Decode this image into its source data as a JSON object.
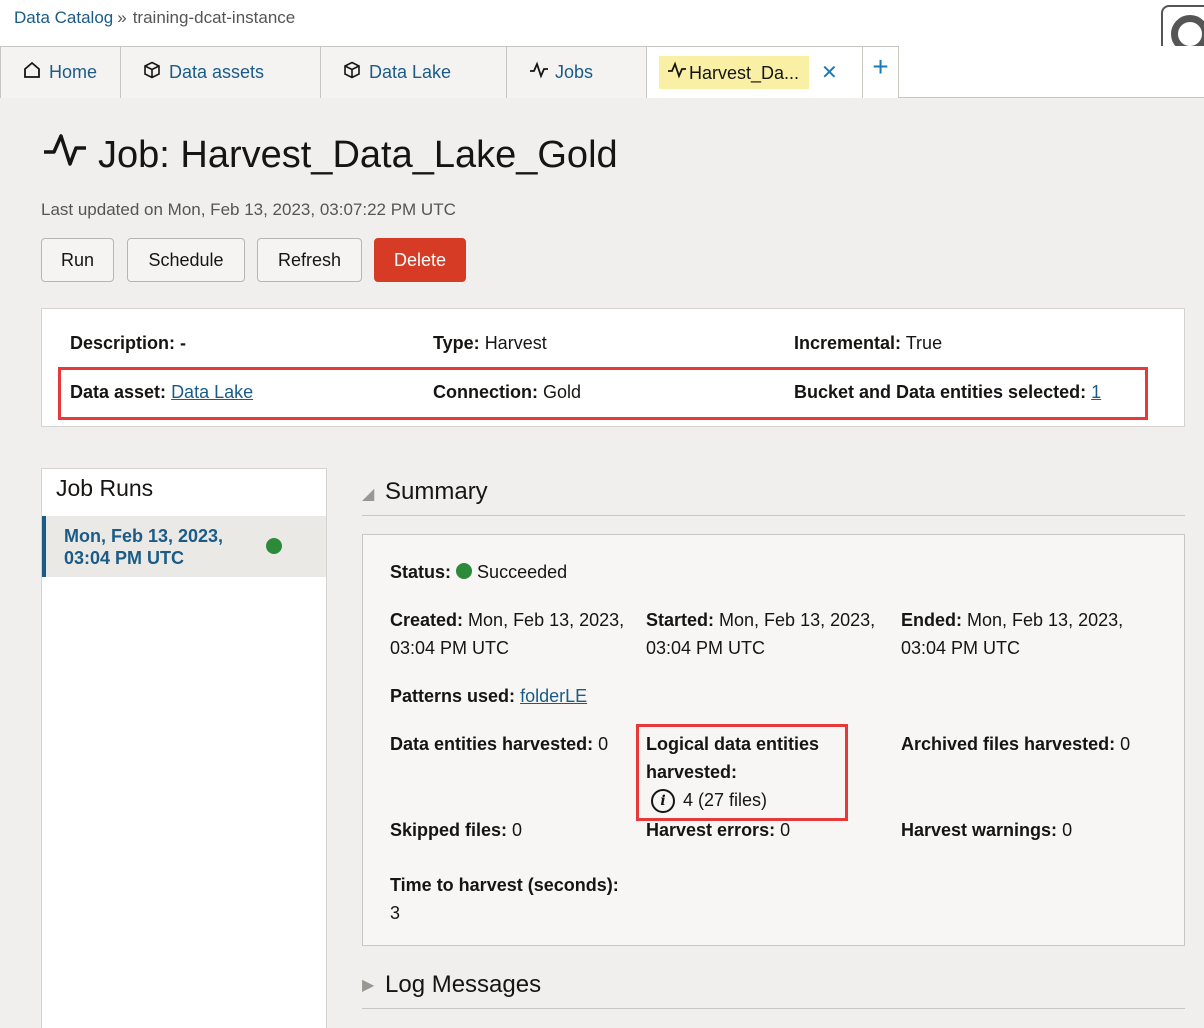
{
  "breadcrumb": {
    "root": "Data Catalog",
    "separator": "»",
    "current": "training-dcat-instance"
  },
  "tabs": [
    {
      "label": "Home",
      "icon": "home-icon"
    },
    {
      "label": "Data assets",
      "icon": "cube-icon"
    },
    {
      "label": "Data Lake",
      "icon": "cube-icon"
    },
    {
      "label": "Jobs",
      "icon": "activity-icon"
    },
    {
      "label": "Harvest_Da...",
      "icon": "activity-icon",
      "active": true
    }
  ],
  "tab_add": "+",
  "tab_close": "✕",
  "page": {
    "title": "Job: Harvest_Data_Lake_Gold",
    "last_updated": "Last updated on Mon, Feb 13, 2023, 03:07:22 PM UTC"
  },
  "actions": {
    "run": "Run",
    "schedule": "Schedule",
    "refresh": "Refresh",
    "delete": "Delete"
  },
  "details": {
    "description_label": "Description:",
    "description_value": "-",
    "type_label": "Type:",
    "type_value": "Harvest",
    "incremental_label": "Incremental:",
    "incremental_value": "True",
    "data_asset_label": "Data asset:",
    "data_asset_value": "Data Lake",
    "connection_label": "Connection:",
    "connection_value": "Gold",
    "bucket_label": "Bucket and Data entities selected:",
    "bucket_value": "1"
  },
  "job_runs": {
    "title": "Job Runs",
    "items": [
      {
        "line1": "Mon, Feb 13, 2023,",
        "line2": "03:04 PM UTC",
        "status_color": "#2d8a3a"
      }
    ]
  },
  "summary": {
    "heading": "Summary",
    "status_label": "Status:",
    "status_value": "Succeeded",
    "created_label": "Created:",
    "created_value1": "Mon, Feb 13, 2023,",
    "created_value2": "03:04 PM UTC",
    "started_label": "Started:",
    "started_value1": "Mon, Feb 13, 2023,",
    "started_value2": "03:04 PM UTC",
    "ended_label": "Ended:",
    "ended_value1": "Mon, Feb 13, 2023,",
    "ended_value2": "03:04 PM UTC",
    "patterns_label": "Patterns used:",
    "patterns_value": "folderLE",
    "entities_label": "Data entities harvested:",
    "entities_value": "0",
    "logical_label1": "Logical data entities",
    "logical_label2": "harvested:",
    "logical_value": "4 (27 files)",
    "archived_label": "Archived files harvested:",
    "archived_value": "0",
    "skipped_label": "Skipped files:",
    "skipped_value": "0",
    "errors_label": "Harvest errors:",
    "errors_value": "0",
    "warnings_label": "Harvest warnings:",
    "warnings_value": "0",
    "time_label": "Time to harvest (seconds):",
    "time_value": "3"
  },
  "log_messages": {
    "heading": "Log Messages"
  },
  "colors": {
    "brand_link": "#1a5c86",
    "danger": "#d63b25",
    "highlight": "#e5393a",
    "success": "#2d8a3a"
  }
}
